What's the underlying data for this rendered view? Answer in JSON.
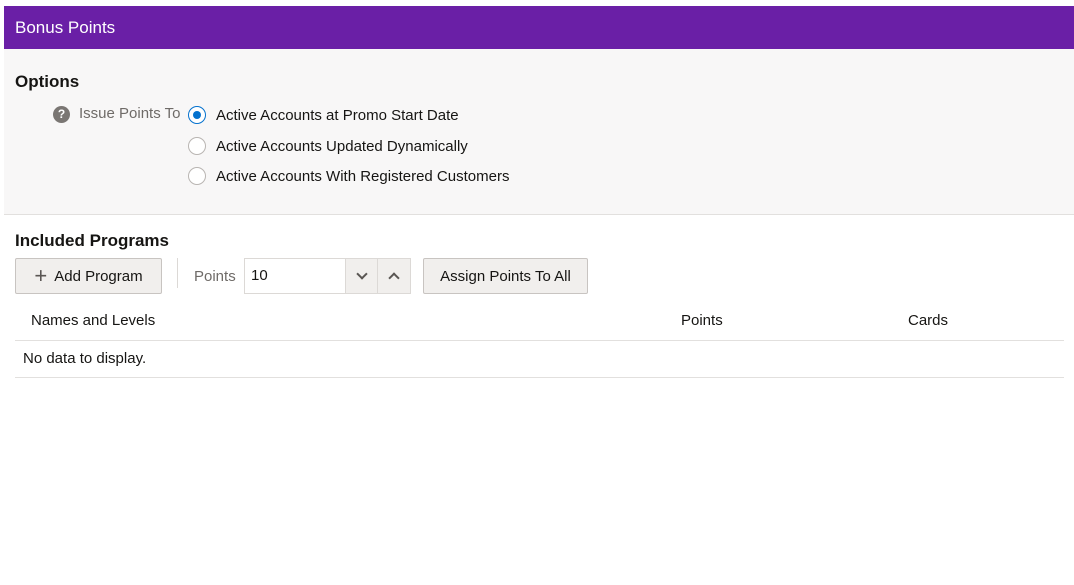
{
  "header": {
    "title": "Bonus Points",
    "color": "#6a1fa6"
  },
  "options": {
    "title": "Options",
    "help_icon": "question-circle-icon",
    "issue_label": "Issue Points To",
    "radios": [
      {
        "label": "Active Accounts at Promo Start Date",
        "checked": true
      },
      {
        "label": "Active Accounts Updated Dynamically",
        "checked": false
      },
      {
        "label": "Active Accounts With Registered Customers",
        "checked": false
      }
    ]
  },
  "programs": {
    "title": "Included Programs",
    "add_button": "Add Program",
    "add_icon": "plus-icon",
    "points_label": "Points",
    "points_value": "10",
    "step_down_icon": "chevron-down-icon",
    "step_up_icon": "chevron-up-icon",
    "assign_button": "Assign Points To All",
    "table": {
      "columns": [
        "Names and Levels",
        "Points",
        "Cards"
      ],
      "empty_text": "No data to display."
    }
  }
}
